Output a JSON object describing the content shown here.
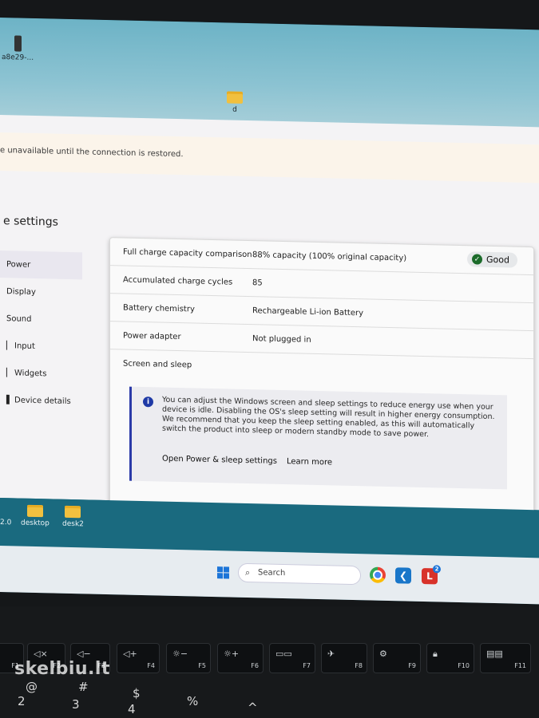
{
  "desktop": {
    "top_icon_label": "a8e29-...",
    "folder_label": "d",
    "bottom_icons": [
      {
        "label": "2.0"
      },
      {
        "label": "desktop"
      },
      {
        "label": "desk2"
      }
    ]
  },
  "banner": {
    "text": "e unavailable until the connection is restored."
  },
  "settings": {
    "title": "e settings",
    "nav": [
      {
        "label": "Power",
        "active": true
      },
      {
        "label": "Display"
      },
      {
        "label": "Sound"
      },
      {
        "label": "Input"
      },
      {
        "label": "Widgets"
      },
      {
        "label": "Device details"
      }
    ]
  },
  "battery": {
    "rows": [
      {
        "label": "Full charge capacity comparison",
        "value": "88% capacity (100% original capacity)"
      },
      {
        "label": "Accumulated charge cycles",
        "value": "85"
      },
      {
        "label": "Battery chemistry",
        "value": "Rechargeable Li-ion Battery"
      },
      {
        "label": "Power adapter",
        "value": "Not plugged in"
      }
    ],
    "status_badge": "Good",
    "section_title": "Screen and sleep",
    "info_text": "You can adjust the Windows screen and sleep settings to reduce energy use when your device is idle. Disabling the OS's sleep setting will result in higher energy consumption. We recommend that you keep the sleep setting enabled, as this will automatically switch the product into sleep or modern standby mode to save power.",
    "link_power": "Open Power & sleep settings",
    "link_learn": "Learn more"
  },
  "taskbar": {
    "search_placeholder": "Search",
    "lapp_badge": "2"
  },
  "keyboard": {
    "keys": [
      "F1",
      "F2",
      "F3",
      "F4",
      "F5",
      "F6",
      "F7",
      "F8",
      "F9",
      "F10",
      "F11"
    ],
    "number_row": [
      "@",
      "2",
      "#",
      "3",
      "$",
      "4",
      "%",
      "^"
    ]
  },
  "watermark": "skelbiu.lt"
}
